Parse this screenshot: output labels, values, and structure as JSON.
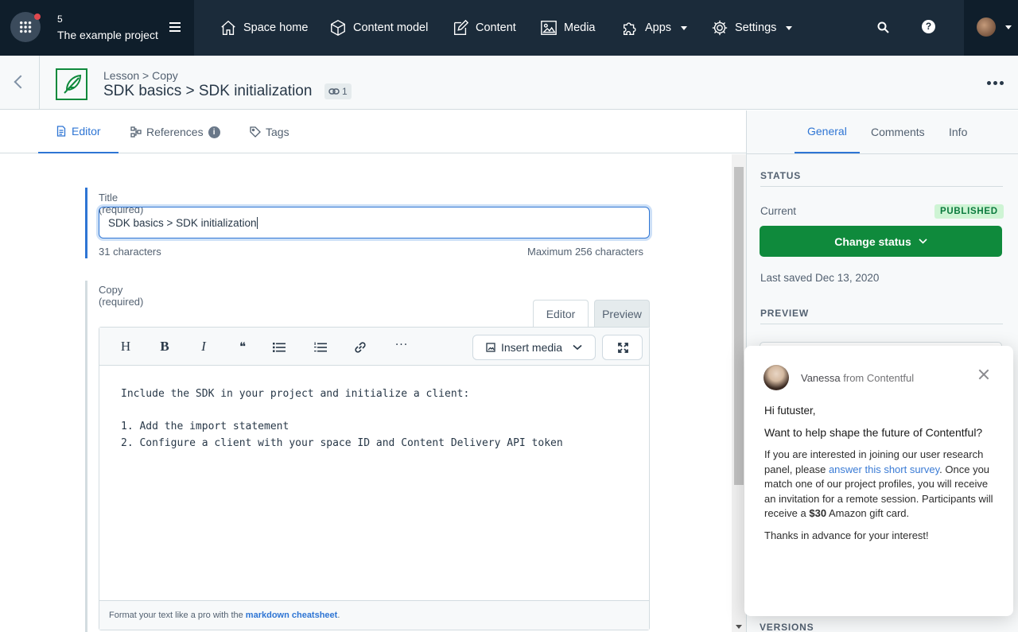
{
  "topnav": {
    "space_number": "5",
    "space_name": "The example project",
    "items": [
      {
        "label": "Space home",
        "icon": "home-icon"
      },
      {
        "label": "Content model",
        "icon": "cube-icon"
      },
      {
        "label": "Content",
        "icon": "edit-icon"
      },
      {
        "label": "Media",
        "icon": "image-icon"
      },
      {
        "label": "Apps",
        "icon": "puzzle-icon"
      },
      {
        "label": "Settings",
        "icon": "gear-icon"
      }
    ],
    "help_label": "?"
  },
  "entry": {
    "breadcrumb": "Lesson > Copy",
    "title": "SDK basics > SDK initialization",
    "link_count": "1"
  },
  "tabs": {
    "editor": "Editor",
    "references": "References",
    "tags": "Tags"
  },
  "title_field": {
    "label": "Title (required)",
    "value": "SDK basics > SDK initialization",
    "char_count": "31 characters",
    "max": "Maximum 256 characters"
  },
  "copy_field": {
    "label": "Copy (required)",
    "mode_editor": "Editor",
    "mode_preview": "Preview",
    "toolbar": {
      "heading": "H",
      "bold": "B",
      "italic": "I",
      "quote": "❝",
      "insert_media": "Insert media"
    },
    "content": "Include the SDK in your project and initialize a client:\n\n1. Add the import statement\n2. Configure a client with your space ID and Content Delivery API token",
    "footer_text": "Format your text like a pro with the ",
    "footer_link": "markdown cheatsheet",
    "footer_end": "."
  },
  "sidebar": {
    "tabs": {
      "general": "General",
      "comments": "Comments",
      "info": "Info"
    },
    "status_heading": "STATUS",
    "current_label": "Current",
    "status_badge": "PUBLISHED",
    "change_status": "Change status",
    "last_saved": "Last saved Dec 13, 2020",
    "preview_heading": "PREVIEW",
    "versions_heading": "VERSIONS"
  },
  "popup": {
    "sender": "Vanessa",
    "from_text": " from Contentful",
    "greeting": "Hi futuster,",
    "question": "Want to help shape the future of Contentful?",
    "body_start": "If you are interested in joining our user research panel, please ",
    "body_link": "answer this short survey",
    "body_mid": ". Once you match one of our project profiles, you will receive an invitation for a remote session. Participants will receive a ",
    "body_amount": "$30",
    "body_end": " Amazon gift card.",
    "thanks": "Thanks in advance for your interest!"
  },
  "colors": {
    "nav_bg": "#1b2b3a",
    "accent": "#2e75d4",
    "published_green": "#0f8a3c"
  }
}
